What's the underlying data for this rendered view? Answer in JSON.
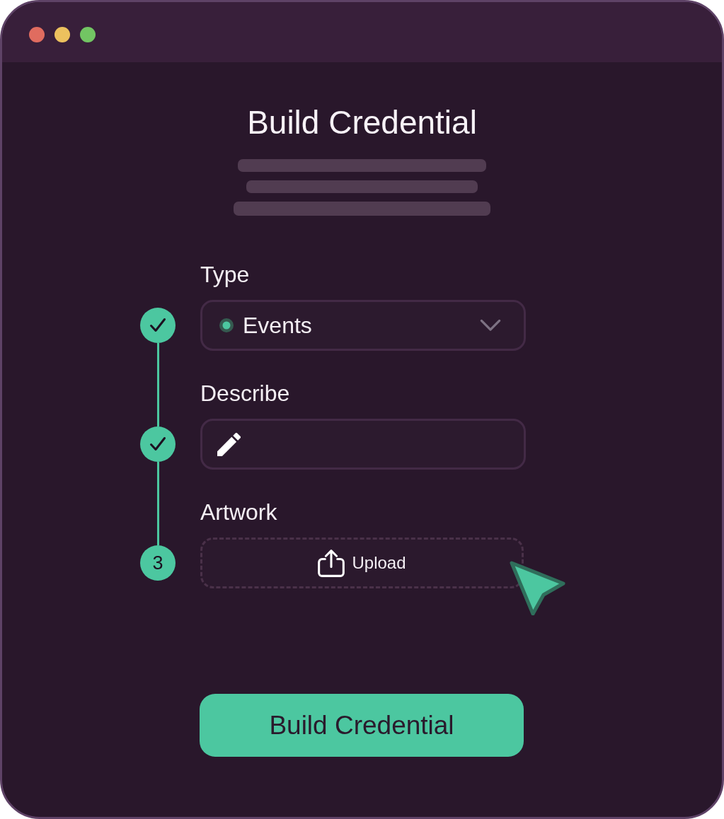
{
  "window": {
    "controls": [
      {
        "color": "#e06c5f"
      },
      {
        "color": "#ecc15e"
      },
      {
        "color": "#72c563"
      }
    ]
  },
  "title": "Build Credential",
  "fields": [
    {
      "kind": "select",
      "label": "Type",
      "value": "Events",
      "step": {
        "done": true
      }
    },
    {
      "kind": "text",
      "label": "Describe",
      "step": {
        "done": true
      }
    },
    {
      "kind": "upload",
      "label": "Artwork",
      "action": "Upload",
      "step": {
        "done": false,
        "number": "3"
      }
    }
  ],
  "submit_button": "Build Credential"
}
